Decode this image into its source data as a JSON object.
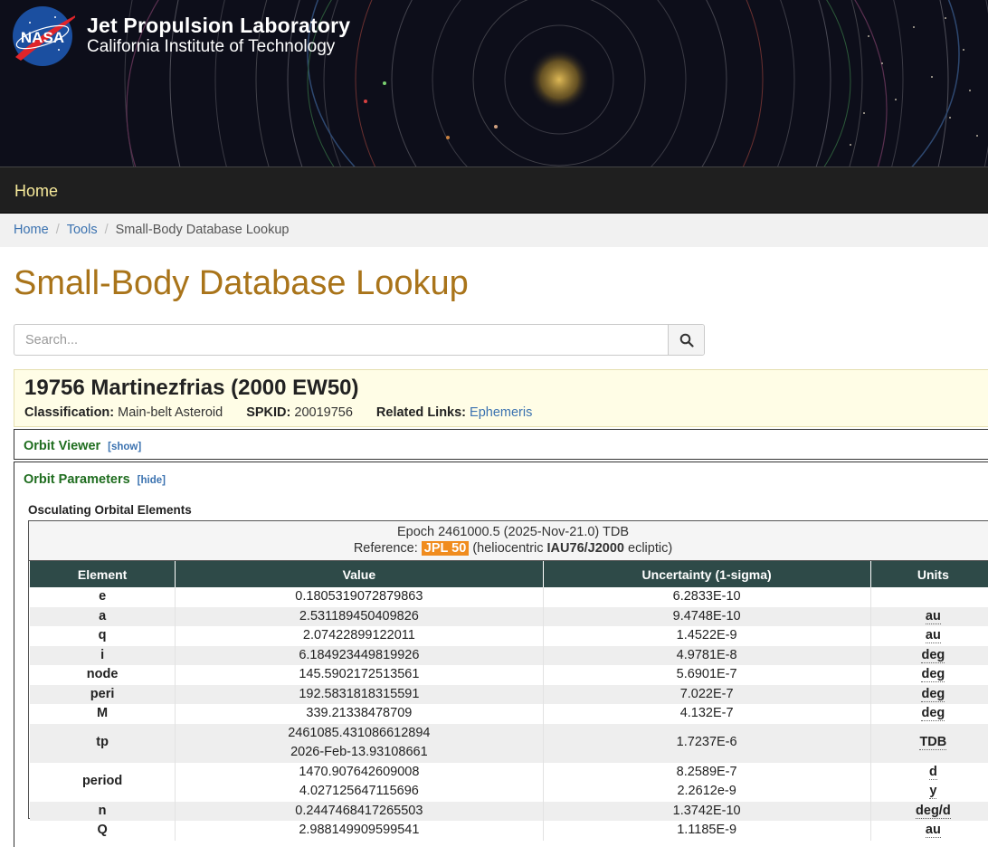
{
  "header": {
    "org_title": "Jet Propulsion Laboratory",
    "org_subtitle": "California Institute of Technology",
    "logo_text": "NASA"
  },
  "nav": {
    "home_label": "Home"
  },
  "breadcrumb": [
    "Home",
    "Tools",
    "Small-Body Database Lookup"
  ],
  "page_title": "Small-Body Database Lookup",
  "search": {
    "placeholder": "Search...",
    "value": ""
  },
  "object": {
    "name": "19756 Martinezfrias (2000 EW50)",
    "classification_label": "Classification:",
    "classification": "Main-belt Asteroid",
    "spkid_label": "SPKID:",
    "spkid": "20019756",
    "related_label": "Related Links:",
    "related_link": "Ephemeris"
  },
  "orbit_viewer": {
    "title": "Orbit Viewer",
    "toggle": "[show]"
  },
  "orbit_params": {
    "title": "Orbit Parameters",
    "toggle": "[hide]"
  },
  "elements": {
    "title": "Osculating Orbital Elements",
    "epoch_line": "Epoch 2461000.5 (2025-Nov-21.0) TDB",
    "reference_prefix": "Reference:",
    "reference_badge": "JPL 50",
    "reference_open": "(heliocentric",
    "reference_frame": "IAU76/J2000",
    "reference_close": "ecliptic)",
    "columns": [
      "Element",
      "Value",
      "Uncertainty (1-sigma)",
      "Units"
    ],
    "rows": [
      {
        "element": "e",
        "values": [
          "0.1805319072879863"
        ],
        "uncertainties": [
          "6.2833E-10"
        ],
        "units": [
          ""
        ]
      },
      {
        "element": "a",
        "values": [
          "2.531189450409826"
        ],
        "uncertainties": [
          "9.4748E-10"
        ],
        "units": [
          "au"
        ]
      },
      {
        "element": "q",
        "values": [
          "2.07422899122011"
        ],
        "uncertainties": [
          "1.4522E-9"
        ],
        "units": [
          "au"
        ]
      },
      {
        "element": "i",
        "values": [
          "6.184923449819926"
        ],
        "uncertainties": [
          "4.9781E-8"
        ],
        "units": [
          "deg"
        ]
      },
      {
        "element": "node",
        "values": [
          "145.5902172513561"
        ],
        "uncertainties": [
          "5.6901E-7"
        ],
        "units": [
          "deg"
        ]
      },
      {
        "element": "peri",
        "values": [
          "192.5831818315591"
        ],
        "uncertainties": [
          "7.022E-7"
        ],
        "units": [
          "deg"
        ]
      },
      {
        "element": "M",
        "values": [
          "339.21338478709"
        ],
        "uncertainties": [
          "4.132E-7"
        ],
        "units": [
          "deg"
        ]
      },
      {
        "element": "tp",
        "values": [
          "2461085.431086612894",
          "2026-Feb-13.93108661"
        ],
        "uncertainties": [
          "1.7237E-6"
        ],
        "units": [
          "TDB"
        ]
      },
      {
        "element": "period",
        "values": [
          "1470.907642609008",
          "4.027125647115696"
        ],
        "uncertainties": [
          "8.2589E-7",
          "2.2612e-9"
        ],
        "units": [
          "d",
          "y"
        ]
      },
      {
        "element": "n",
        "values": [
          "0.2447468417265503"
        ],
        "uncertainties": [
          "1.3742E-10"
        ],
        "units": [
          "deg/d"
        ]
      },
      {
        "element": "Q",
        "values": [
          "2.988149909599541"
        ],
        "uncertainties": [
          "1.1185E-9"
        ],
        "units": [
          "au"
        ]
      }
    ]
  }
}
